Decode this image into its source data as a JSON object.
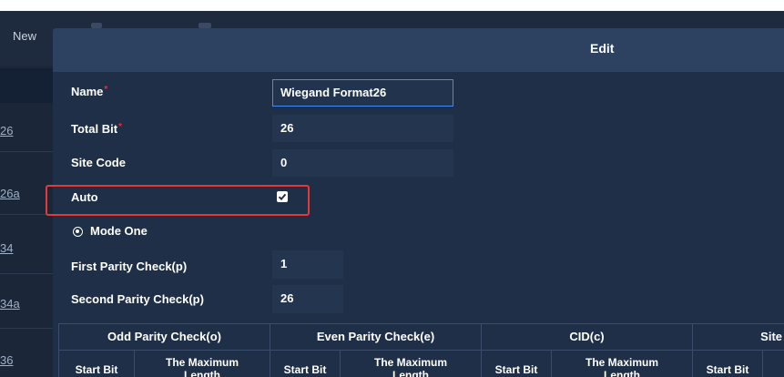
{
  "background": {
    "toolbar_new": "New",
    "list_items": [
      "26",
      "26a",
      "34",
      "34a",
      "36"
    ]
  },
  "dialog": {
    "title": "Edit",
    "fields": {
      "name": {
        "label": "Name",
        "required": "*",
        "value": "Wiegand Format26"
      },
      "total_bit": {
        "label": "Total Bit",
        "required": "*",
        "value": "26"
      },
      "site_code": {
        "label": "Site Code",
        "value": "0"
      },
      "auto": {
        "label": "Auto",
        "checked": true
      },
      "mode": {
        "label": "Mode One",
        "selected": true
      },
      "first_parity": {
        "label": "First Parity Check(p)",
        "value": "1"
      },
      "second_parity": {
        "label": "Second Parity Check(p)",
        "value": "26"
      }
    },
    "table": {
      "groups": [
        "Odd Parity Check(o)",
        "Even Parity Check(e)",
        "CID(c)",
        "Site"
      ],
      "sub_start": "Start Bit",
      "sub_max_line1": "The Maximum",
      "sub_max_line2": "Length"
    }
  },
  "colors": {
    "dialog_bg": "#1f2f47",
    "header_bg": "#2d4160",
    "field_bg": "#24364f",
    "focus_border": "#3d8df5",
    "required": "#e0323c",
    "highlight": "#e53935"
  },
  "icons": [
    "checkbox-checked-icon",
    "radio-selected-icon"
  ]
}
